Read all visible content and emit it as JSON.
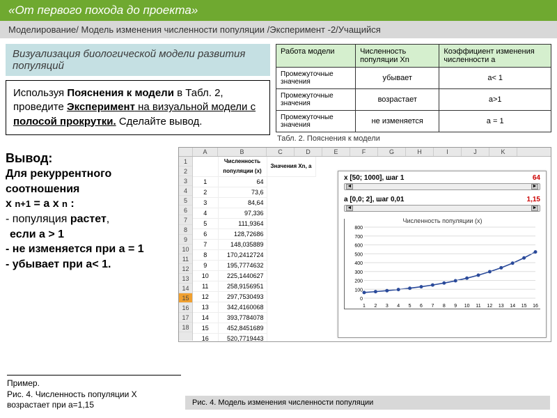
{
  "header": {
    "title": "«От первого похода до проекта»"
  },
  "breadcrumb": "Моделирование/ Модель изменения численности популяции /Эксперимент -2/Учащийся",
  "vis_title": "Визуализация биологической модели развития популяций",
  "instruction": {
    "pre": "Используя ",
    "b1": "Пояснения к модели",
    "mid1": " в Табл. 2, проведите ",
    "b2": "Эксперимент",
    "mid2": " на визуальной модели с ",
    "b3": "полосой прокрутки.",
    "post": " Сделайте вывод."
  },
  "table2": {
    "headers": [
      "Работа модели",
      "Численность популяции Xn",
      "Коэффициент изменения численности a"
    ],
    "rows": [
      [
        "Промежуточные значения",
        "убывает",
        "a< 1"
      ],
      [
        "Промежуточные значения",
        "возрастает",
        "a>1"
      ],
      [
        "Промежуточные значения",
        "не изменяется",
        "a = 1"
      ]
    ],
    "caption": "Табл. 2. Пояснения к модели"
  },
  "conclusion": {
    "hdr": "Вывод:",
    "line1": "Для рекуррентного соотношения",
    "formula": " x n+1 = a x n :",
    "p1a": "- популяция ",
    "p1b": "растет",
    "p1c": ",",
    "p2": "если a > 1",
    "p3": "- не изменяется при a = 1",
    "p4": "- убывает при a< 1."
  },
  "spreadsheet": {
    "cols": [
      "",
      "A",
      "B",
      "C",
      "D",
      "E",
      "F",
      "G",
      "H",
      "I",
      "J",
      "K"
    ],
    "title_row": [
      "",
      "Численность популяции (x)",
      "Значения Xn, a"
    ],
    "rows": [
      [
        "1",
        "64"
      ],
      [
        "2",
        "73,6"
      ],
      [
        "3",
        "84,64"
      ],
      [
        "4",
        "97,336"
      ],
      [
        "5",
        "111,9364"
      ],
      [
        "6",
        "128,72686"
      ],
      [
        "7",
        "148,035889"
      ],
      [
        "8",
        "170,2412724"
      ],
      [
        "9",
        "195,7774632"
      ],
      [
        "10",
        "225,1440627"
      ],
      [
        "11",
        "258,9156951"
      ],
      [
        "12",
        "297,7530493"
      ],
      [
        "13",
        "342,4160068"
      ],
      [
        "14",
        "393,7784078"
      ],
      [
        "15",
        "452,8451689"
      ],
      [
        "16",
        "520,7719443"
      ]
    ],
    "slider_x": {
      "label": "x [50; 1000], шаг 1",
      "value": "64"
    },
    "slider_a": {
      "label": "a [0,0; 2], шаг 0,01",
      "value": "1,15"
    }
  },
  "chart_title": "Численность популяции (x)",
  "chart_data": {
    "type": "line",
    "title": "Численность популяции (x)",
    "xlabel": "",
    "ylabel": "",
    "x": [
      1,
      2,
      3,
      4,
      5,
      6,
      7,
      8,
      9,
      10,
      11,
      12,
      13,
      14,
      15,
      16
    ],
    "values": [
      64,
      73.6,
      84.64,
      97.34,
      111.94,
      128.73,
      148.04,
      170.24,
      195.78,
      225.14,
      258.92,
      297.75,
      342.42,
      393.78,
      452.85,
      520.77
    ],
    "ylim": [
      0,
      800
    ],
    "grid": true
  },
  "example_caption": {
    "l1": "Пример.",
    "l2": "Рис. 4. Численность популяции X возрастает при a=1,15"
  },
  "footer_caption": "Рис. 4. Модель изменения численности популяции"
}
